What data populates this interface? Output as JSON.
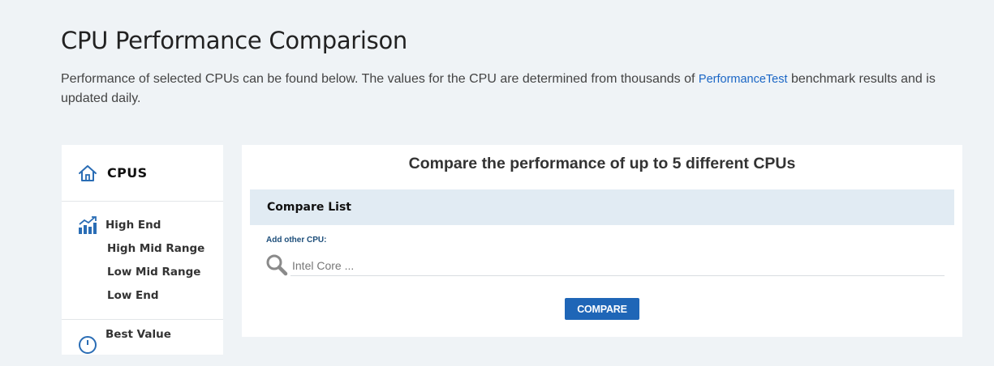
{
  "page": {
    "title": "CPU Performance Comparison",
    "intro_before": "Performance of selected CPUs can be found below. The values for the CPU are determined from thousands of ",
    "intro_link": "PerformanceTest",
    "intro_after": " benchmark results and is updated daily."
  },
  "sidebar": {
    "header": "CPUS",
    "sections": [
      {
        "label": "High End",
        "sub_items": [
          "High Mid Range",
          "Low Mid Range",
          "Low End"
        ]
      },
      {
        "label": "Best Value"
      }
    ]
  },
  "compare": {
    "heading": "Compare the performance of up to 5 different CPUs",
    "list_header": "Compare List",
    "add_label": "Add other CPU:",
    "search_placeholder": "Intel Core ...",
    "search_value": "",
    "button_label": "COMPARE"
  },
  "icons": {
    "header": "home-icon",
    "high_end": "chart-growth-icon",
    "best_value": "circle-icon",
    "search": "search-icon"
  },
  "colors": {
    "background": "#eff3f6",
    "link": "#1a66c5",
    "accent": "#1f66b7",
    "list_header_bg": "#e1ebf3"
  }
}
